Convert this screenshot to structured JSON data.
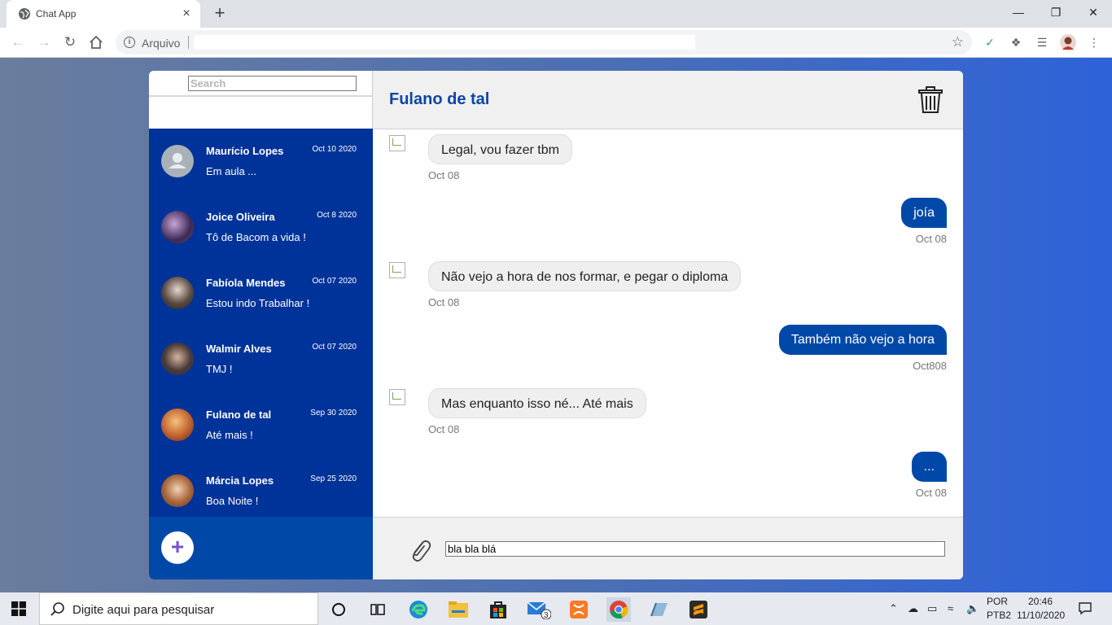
{
  "browser": {
    "tab_title": "Chat App",
    "tab_close": "×",
    "new_tab": "+",
    "address_scheme": "Arquivo",
    "window_minimize": "—",
    "window_restore": "❐",
    "window_close": "✕"
  },
  "sidebar": {
    "search_placeholder": "Search",
    "contacts": [
      {
        "name": "Maurício Lopes",
        "date": "Oct 10 2020",
        "last_message": "Em aula ..."
      },
      {
        "name": "Joice Oliveira",
        "date": "Oct 8 2020",
        "last_message": "Tô de Bacom a vida !"
      },
      {
        "name": "Fabíola Mendes",
        "date": "Oct 07 2020",
        "last_message": "Estou indo Trabalhar !"
      },
      {
        "name": "Walmir Alves",
        "date": "Oct 07 2020",
        "last_message": "TMJ !"
      },
      {
        "name": "Fulano de tal",
        "date": "Sep 30 2020",
        "last_message": "Até mais !"
      },
      {
        "name": "Márcia Lopes",
        "date": "Sep 25 2020",
        "last_message": "Boa Noite !"
      }
    ],
    "add_button": "+"
  },
  "chat": {
    "title": "Fulano de tal",
    "messages": [
      {
        "direction": "in",
        "text": "Legal, vou fazer tbm",
        "time": "Oct 08"
      },
      {
        "direction": "out",
        "text": "joía",
        "time": "Oct 08"
      },
      {
        "direction": "in",
        "text": "Não vejo a hora de nos formar, e pegar o diploma",
        "time": "Oct 08"
      },
      {
        "direction": "out",
        "text": "Também não vejo a hora",
        "time": "Oct808"
      },
      {
        "direction": "in",
        "text": "Mas enquanto isso né... Até mais",
        "time": "Oct 08"
      },
      {
        "direction": "out",
        "text": "...",
        "time": "Oct 08"
      }
    ],
    "input_value": "bla bla blá"
  },
  "taskbar": {
    "search_placeholder": "Digite aqui para pesquisar",
    "mail_badge": "3",
    "lang_top": "POR",
    "lang_bottom": "PTB2",
    "time": "20:46",
    "date": "11/10/2020"
  },
  "colors": {
    "sidebar_blue": "#003399",
    "accent_blue": "#0048a8",
    "header_title": "#0a45a6"
  }
}
